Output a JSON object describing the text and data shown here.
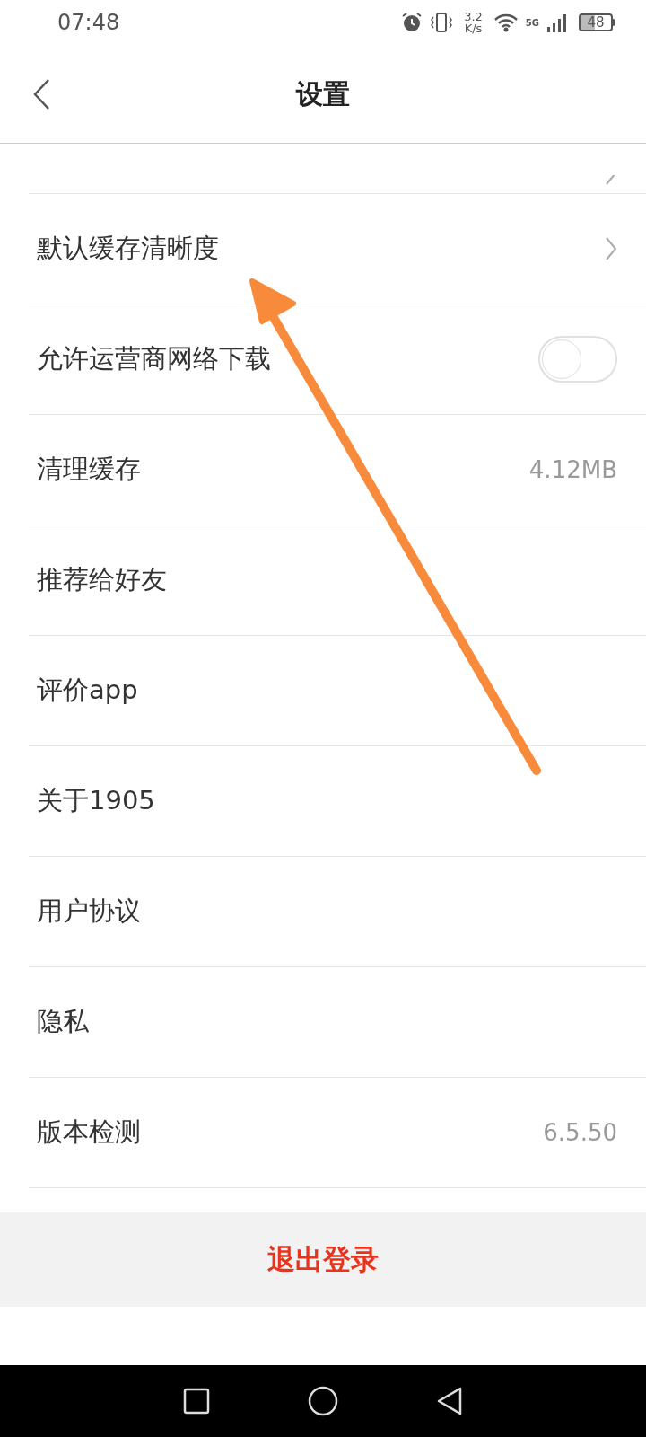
{
  "status_bar": {
    "time": "07:48",
    "speed_value": "3.2",
    "speed_unit": "K/s",
    "network": "5G",
    "battery": "48"
  },
  "header": {
    "title": "设置"
  },
  "rows": [
    {
      "kind": "chevron"
    },
    {
      "kind": "chevron",
      "label": "默认缓存清晰度"
    },
    {
      "kind": "toggle",
      "label": "允许运营商网络下载",
      "on": false
    },
    {
      "kind": "value",
      "label": "清理缓存",
      "value": "4.12MB"
    },
    {
      "kind": "plain",
      "label": "推荐给好友"
    },
    {
      "kind": "plain",
      "label": "评价app"
    },
    {
      "kind": "plain",
      "label": "关于1905"
    },
    {
      "kind": "plain",
      "label": "用户协议"
    },
    {
      "kind": "plain",
      "label": "隐私"
    },
    {
      "kind": "value",
      "label": "版本检测",
      "value": "6.5.50"
    }
  ],
  "logout_button": "退出登录"
}
